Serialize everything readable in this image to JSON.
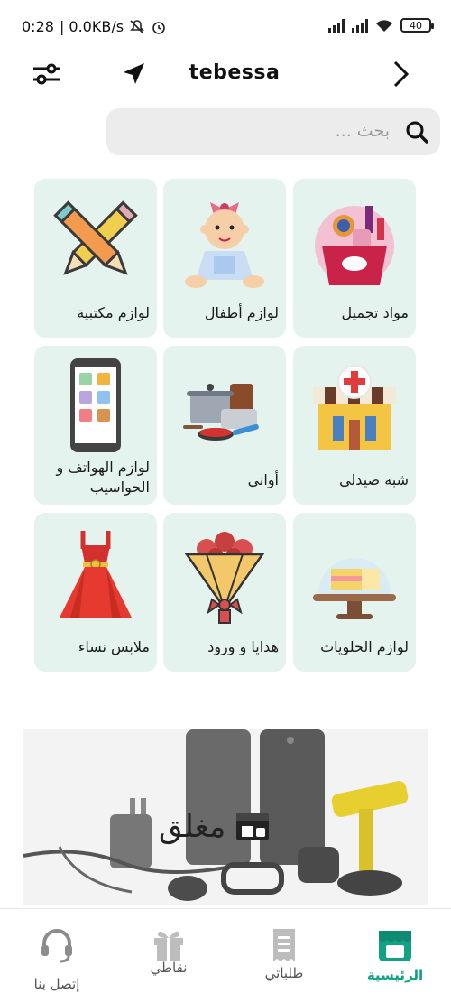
{
  "status_bar": {
    "time": "0:28",
    "network_speed": "| 0.0KB/s",
    "battery": "40"
  },
  "header": {
    "city": "tebessa",
    "filter_icon": "sliders-icon",
    "location_icon": "navigation-arrow-icon",
    "forward_icon": "chevron-right-icon"
  },
  "search": {
    "placeholder": "بحث ..."
  },
  "categories": [
    {
      "label": "مواد تجميل",
      "icon": "cosmetics-icon"
    },
    {
      "label": "لوازم أطفال",
      "icon": "baby-icon"
    },
    {
      "label": "لوازم مكتبية",
      "icon": "pencils-icon"
    },
    {
      "label": "شبه صيدلي",
      "icon": "pharmacy-icon"
    },
    {
      "label": "أواني",
      "icon": "cookware-icon"
    },
    {
      "label": "لوازم الهواتف و الحواسيب",
      "icon": "phone-icon"
    },
    {
      "label": "لوازم الحلويات",
      "icon": "cake-icon"
    },
    {
      "label": "هدايا و ورود",
      "icon": "bouquet-icon"
    },
    {
      "label": "ملابس نساء",
      "icon": "dress-icon"
    }
  ],
  "banner": {
    "closed_label": "مغلق"
  },
  "bottom_nav": {
    "home": "الرئيسية",
    "orders": "طلباتي",
    "points": "نقاطي",
    "contact": "إتصل بنا"
  },
  "colors": {
    "accent": "#11a183",
    "tile_bg": "#e5f3ee",
    "search_bg": "#ececec"
  }
}
